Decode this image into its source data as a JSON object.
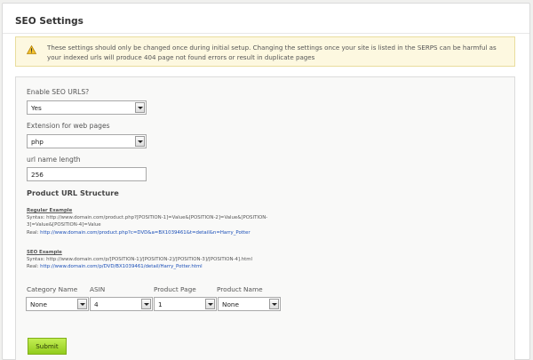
{
  "page": {
    "title": "SEO Settings"
  },
  "warning": {
    "icon": "warning-triangle-icon",
    "text": "These settings should only be changed once during initial setup. Changing the settings once your site is listed in the SERPS can be harmful as your indexed urls will produce 404 page not found errors or result in duplicate pages"
  },
  "form": {
    "enable_seo": {
      "label": "Enable SEO URLS?",
      "value": "Yes"
    },
    "extension": {
      "label": "Extension for web pages",
      "value": "php"
    },
    "url_length": {
      "label": "url name length",
      "value": "256"
    },
    "structure_title": "Product URL Structure",
    "regular_example": {
      "heading": "Regular Example",
      "syntax_line1": "Syntax: http://www.domain.com/product.php?[POSITION-1]=Value&[POSITION-2]=Value&[POSITION-",
      "syntax_line2": "3]=Value&[POSITION-4]=Value",
      "real_label": "Real: ",
      "real_url": "http://www.domain.com/product.php?c=DVD&a=BX1039461&t=detail&n=Harry_Potter"
    },
    "seo_example": {
      "heading": "SEO Example",
      "syntax_line1": "Syntax: http://www.domain.com/p/[POSITION-1]/[POSITION-2]/[POSITION-3]/[POSITION-4].html",
      "real_label": "Real: ",
      "real_url": "http://www.domain.com/p/DVD/BX1039461/detail/Harry_Potter.html"
    },
    "positions": [
      {
        "label": "Category Name",
        "value": "None"
      },
      {
        "label": "ASIN",
        "value": "4"
      },
      {
        "label": "Product Page",
        "value": "1"
      },
      {
        "label": "Product Name",
        "value": "None"
      }
    ],
    "submit_label": "Submit"
  },
  "colors": {
    "warning_bg": "#fdf8e0",
    "link": "#1a4fb8",
    "submit": "#a6dc2a"
  }
}
